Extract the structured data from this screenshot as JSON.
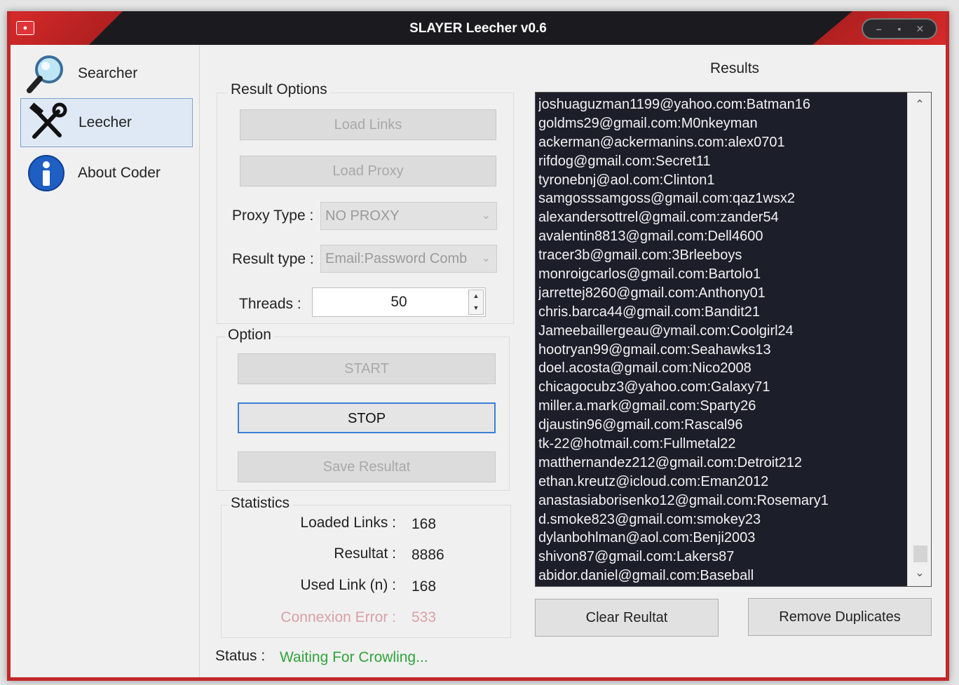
{
  "window": {
    "title": "SLAYER Leecher v0.6",
    "controls": [
      "–",
      "▪",
      "✕"
    ]
  },
  "sidebar": {
    "items": [
      {
        "label": "Searcher",
        "icon": "magnifier-icon",
        "active": false
      },
      {
        "label": "Leecher",
        "icon": "tools-icon",
        "active": true
      },
      {
        "label": "About Coder",
        "icon": "info-icon",
        "active": false
      }
    ]
  },
  "result_options": {
    "label": "Result Options",
    "load_links": "Load Links",
    "load_proxy": "Load Proxy",
    "proxy_type_label": "Proxy Type :",
    "proxy_type_value": "NO PROXY",
    "result_type_label": "Result type :",
    "result_type_value": "Email:Password Comb",
    "threads_label": "Threads :",
    "threads_value": "50"
  },
  "option": {
    "label": "Option",
    "start": "START",
    "stop": "STOP",
    "save": "Save Resultat"
  },
  "statistics": {
    "label": "Statistics",
    "loaded_links_label": "Loaded Links :",
    "loaded_links_value": "168",
    "resultat_label": "Resultat :",
    "resultat_value": "8886",
    "used_link_label": "Used Link (n) :",
    "used_link_value": "168",
    "connexion_error_label": "Connexion Error :",
    "connexion_error_value": "533"
  },
  "status": {
    "label": "Status :",
    "value": "Waiting For Crowling..."
  },
  "results": {
    "label": "Results",
    "items": [
      "joshuaguzman1199@yahoo.com:Batman16",
      "goldms29@gmail.com:M0nkeyman",
      "ackerman@ackermanins.com:alex0701",
      "rifdog@gmail.com:Secret11",
      "tyronebnj@aol.com:Clinton1",
      "samgosssamgoss@gmail.com:qaz1wsx2",
      "alexandersottrel@gmail.com:zander54",
      "avalentin8813@gmail.com:Dell4600",
      "tracer3b@gmail.com:3Brleeboys",
      "monroigcarlos@gmail.com:Bartolo1",
      "jarrettej8260@gmail.com:Anthony01",
      "chris.barca44@gmail.com:Bandit21",
      "Jameebaillergeau@ymail.com:Coolgirl24",
      "hootryan99@gmail.com:Seahawks13",
      "doel.acosta@gmail.com:Nico2008",
      "chicagocubz3@yahoo.com:Galaxy71",
      "miller.a.mark@gmail.com:Sparty26",
      "djaustin96@gmail.com:Rascal96",
      "tk-22@hotmail.com:Fullmetal22",
      "matthernandez212@gmail.com:Detroit212",
      "ethan.kreutz@icloud.com:Eman2012",
      "anastasiaborisenko12@gmail.com:Rosemary1",
      "d.smoke823@gmail.com:smokey23",
      "dylanbohlman@aol.com:Benji2003",
      "shivon87@gmail.com:Lakers87",
      "abidor.daniel@gmail.com:Baseball"
    ],
    "clear_button": "Clear Reultat",
    "remove_duplicates_button": "Remove Duplicates"
  },
  "colors": {
    "accent_red": "#c0282a",
    "status_green": "#2fa43a",
    "error_pink": "#d9a0a6",
    "results_bg": "#1c1e2a"
  }
}
